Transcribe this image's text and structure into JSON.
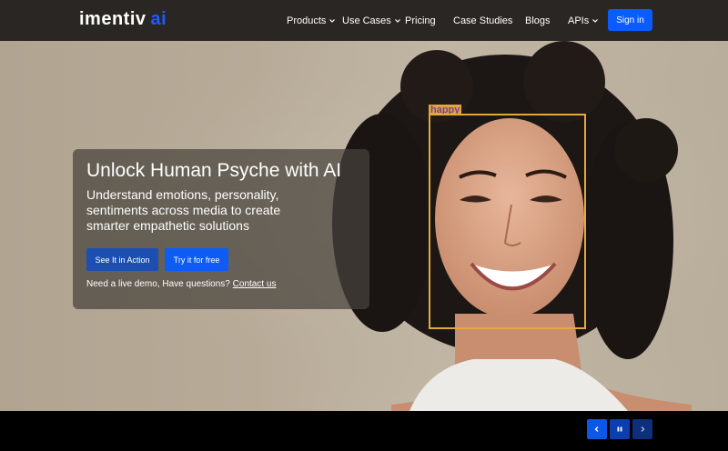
{
  "brand": {
    "logo_main": "imentiv",
    "logo_ai": "ai"
  },
  "nav": {
    "items": [
      {
        "label": "Products",
        "dropdown": true
      },
      {
        "label": "Use Cases",
        "dropdown": true
      },
      {
        "label": "Pricing",
        "dropdown": false
      },
      {
        "label": "Case Studies",
        "dropdown": false
      },
      {
        "label": "Blogs",
        "dropdown": false
      },
      {
        "label": "APIs",
        "dropdown": true
      }
    ],
    "signin_label": "Sign in"
  },
  "hero": {
    "title": "Unlock Human Psyche with AI",
    "subtitle": "Understand emotions, personality, sentiments across media to create smarter empathetic solutions",
    "primary_button": "See It in Action",
    "secondary_button": "Try it for free",
    "footer_text": "Need a live demo, Have questions?",
    "footer_link": "Contact us",
    "detection_label": "happy"
  },
  "carousel": {
    "prev_icon": "chevron-left-icon",
    "pause_icon": "pause-icon",
    "next_icon": "chevron-right-icon"
  },
  "colors": {
    "header_bg": "#2a2624",
    "accent": "#0a5cff",
    "detection": "#e4a93b"
  }
}
